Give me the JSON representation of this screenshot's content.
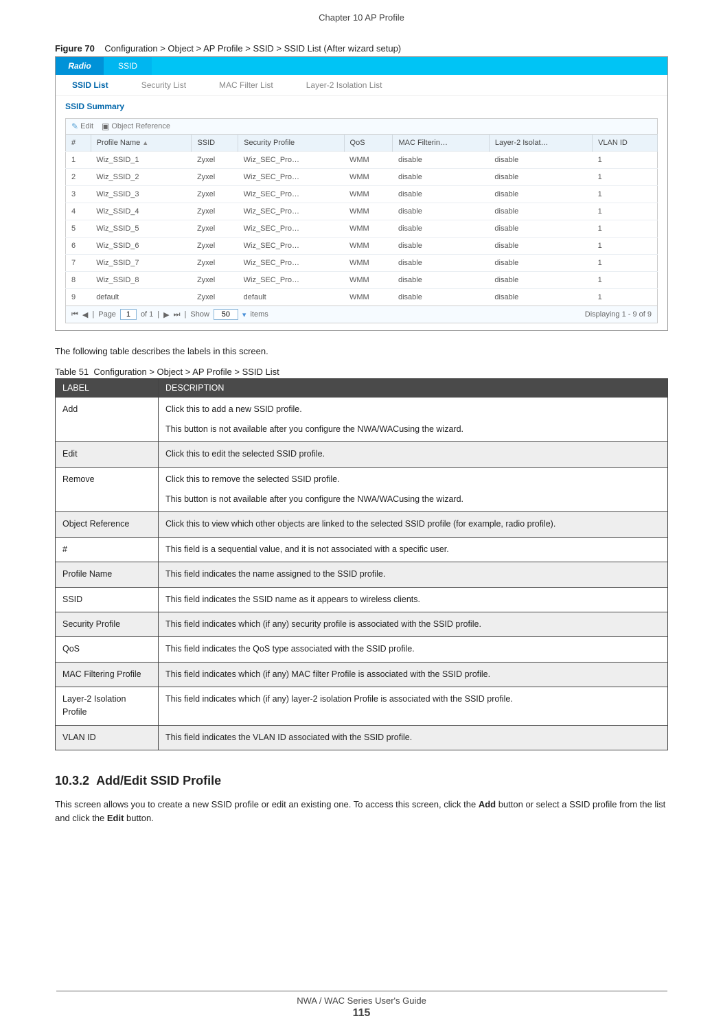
{
  "header": {
    "chapter": "Chapter 10 AP Profile"
  },
  "figure": {
    "label": "Figure 70",
    "caption": "Configuration > Object > AP Profile > SSID > SSID List (After wizard setup)"
  },
  "screenshot": {
    "top_tabs": {
      "radio": "Radio",
      "ssid": "SSID"
    },
    "sub_tabs": [
      "SSID List",
      "Security List",
      "MAC Filter List",
      "Layer-2 Isolation List"
    ],
    "section": "SSID Summary",
    "toolbar": {
      "edit": "Edit",
      "objref": "Object Reference"
    },
    "columns": [
      "#",
      "Profile Name",
      "SSID",
      "Security Profile",
      "QoS",
      "MAC Filterin…",
      "Layer-2 Isolat…",
      "VLAN ID"
    ],
    "rows": [
      {
        "n": "1",
        "pn": "Wiz_SSID_1",
        "ssid": "Zyxel",
        "sp": "Wiz_SEC_Pro…",
        "q": "WMM",
        "mf": "disable",
        "l2": "disable",
        "v": "1"
      },
      {
        "n": "2",
        "pn": "Wiz_SSID_2",
        "ssid": "Zyxel",
        "sp": "Wiz_SEC_Pro…",
        "q": "WMM",
        "mf": "disable",
        "l2": "disable",
        "v": "1"
      },
      {
        "n": "3",
        "pn": "Wiz_SSID_3",
        "ssid": "Zyxel",
        "sp": "Wiz_SEC_Pro…",
        "q": "WMM",
        "mf": "disable",
        "l2": "disable",
        "v": "1"
      },
      {
        "n": "4",
        "pn": "Wiz_SSID_4",
        "ssid": "Zyxel",
        "sp": "Wiz_SEC_Pro…",
        "q": "WMM",
        "mf": "disable",
        "l2": "disable",
        "v": "1"
      },
      {
        "n": "5",
        "pn": "Wiz_SSID_5",
        "ssid": "Zyxel",
        "sp": "Wiz_SEC_Pro…",
        "q": "WMM",
        "mf": "disable",
        "l2": "disable",
        "v": "1"
      },
      {
        "n": "6",
        "pn": "Wiz_SSID_6",
        "ssid": "Zyxel",
        "sp": "Wiz_SEC_Pro…",
        "q": "WMM",
        "mf": "disable",
        "l2": "disable",
        "v": "1"
      },
      {
        "n": "7",
        "pn": "Wiz_SSID_7",
        "ssid": "Zyxel",
        "sp": "Wiz_SEC_Pro…",
        "q": "WMM",
        "mf": "disable",
        "l2": "disable",
        "v": "1"
      },
      {
        "n": "8",
        "pn": "Wiz_SSID_8",
        "ssid": "Zyxel",
        "sp": "Wiz_SEC_Pro…",
        "q": "WMM",
        "mf": "disable",
        "l2": "disable",
        "v": "1"
      },
      {
        "n": "9",
        "pn": "default",
        "ssid": "Zyxel",
        "sp": "default",
        "q": "WMM",
        "mf": "disable",
        "l2": "disable",
        "v": "1"
      }
    ],
    "pager": {
      "page_label": "Page",
      "page": "1",
      "of": "of 1",
      "show": "Show",
      "show_val": "50",
      "items": "items",
      "display": "Displaying 1 - 9 of 9"
    }
  },
  "intro_text": "The following table describes the labels in this screen.",
  "table51": {
    "caption_label": "Table 51",
    "caption": "Configuration > Object > AP Profile > SSID List",
    "head": {
      "label": "LABEL",
      "desc": "DESCRIPTION"
    },
    "rows": [
      {
        "l": "Add",
        "d": "Click this to add a new SSID profile.",
        "d2": "This button is not available after you configure the NWA/WACusing the wizard."
      },
      {
        "l": "Edit",
        "d": "Click this to edit the selected SSID profile."
      },
      {
        "l": "Remove",
        "d": "Click this to remove the selected SSID profile.",
        "d2": "This button is not available after you configure the NWA/WACusing the wizard."
      },
      {
        "l": "Object Reference",
        "d": "Click this to view which other objects are linked to the selected SSID profile (for example, radio profile)."
      },
      {
        "l": "#",
        "d": "This field is a sequential value, and it is not associated with a specific user."
      },
      {
        "l": "Profile Name",
        "d": "This field indicates the name assigned to the SSID profile."
      },
      {
        "l": "SSID",
        "d": "This field indicates the SSID name as it appears to wireless clients."
      },
      {
        "l": "Security Profile",
        "d": "This field indicates which (if any) security profile is associated with the SSID profile."
      },
      {
        "l": "QoS",
        "d": "This field indicates the QoS type associated with the SSID profile."
      },
      {
        "l": "MAC Filtering Profile",
        "d": "This field indicates which (if any) MAC filter Profile is associated with the SSID profile."
      },
      {
        "l": "Layer-2 Isolation Profile",
        "d": "This field indicates which (if any) layer-2 isolation Profile is associated with the SSID profile."
      },
      {
        "l": "VLAN ID",
        "d": "This field indicates the VLAN ID associated with the SSID profile."
      }
    ]
  },
  "subsection": {
    "number": "10.3.2",
    "title": "Add/Edit SSID Profile",
    "para_a": "This screen allows you to create a new SSID profile or edit an existing one. To access this screen, click the ",
    "add": "Add",
    "para_b": " button or select a SSID profile from the list and click the ",
    "edit": "Edit",
    "para_c": " button."
  },
  "footer": {
    "guide": "NWA / WAC Series User's Guide",
    "page": "115"
  }
}
